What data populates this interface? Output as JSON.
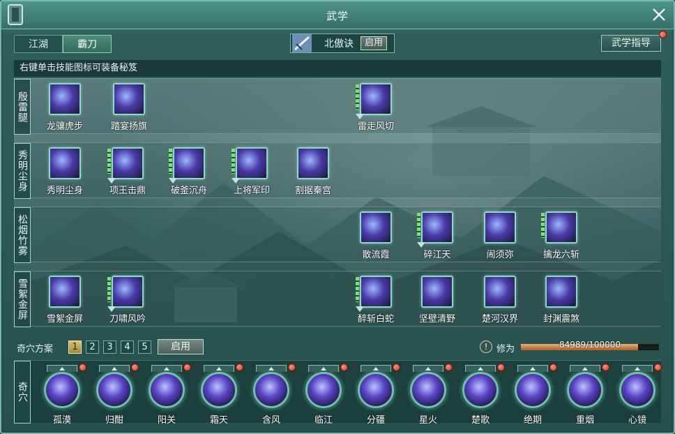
{
  "window": {
    "title": "武学"
  },
  "tabs": [
    {
      "label": "江湖"
    },
    {
      "label": "霸刀"
    }
  ],
  "skill_set": {
    "name": "北傲诀",
    "enable": "启用"
  },
  "guide_button": "武学指导",
  "hint": "右键单击技能图标可装备秘笈",
  "rows": [
    {
      "label": "殷雷腿",
      "skills": [
        "龙骧虎步",
        "踏宴扬旗",
        "雷走风切"
      ]
    },
    {
      "label": "秀明尘身",
      "skills": [
        "秀明尘身",
        "项王击鼎",
        "破釜沉舟",
        "上将军印",
        "割据秦宫"
      ]
    },
    {
      "label": "松烟竹雾",
      "skills": [
        "散流霞",
        "碎江天",
        "闹须弥",
        "擒龙六斩"
      ]
    },
    {
      "label": "雪絮金屏",
      "skills": [
        "雪絮金屏",
        "刀啸风吟",
        "醉斩白蛇",
        "坚壁清野",
        "楚河汉界",
        "封渊震煞"
      ]
    }
  ],
  "qixue": {
    "title": "奇穴方案",
    "plans": [
      "1",
      "2",
      "3",
      "4",
      "5"
    ],
    "enable": "启用",
    "xiuwei_icon": "!",
    "xiuwei_label": "修为",
    "xiuwei_text": "84989/100000",
    "xiuwei_progress": 0.84989,
    "row_label": "奇穴",
    "items": [
      "孤漠",
      "归酣",
      "阳关",
      "霜天",
      "含风",
      "临江",
      "分疆",
      "星火",
      "楚歌",
      "绝期",
      "重烟",
      "心镜"
    ]
  },
  "colors": {
    "accent": "#8fd9c7",
    "panel": "#2f5e58",
    "progress": "#c78648",
    "notify": "#d63624"
  }
}
